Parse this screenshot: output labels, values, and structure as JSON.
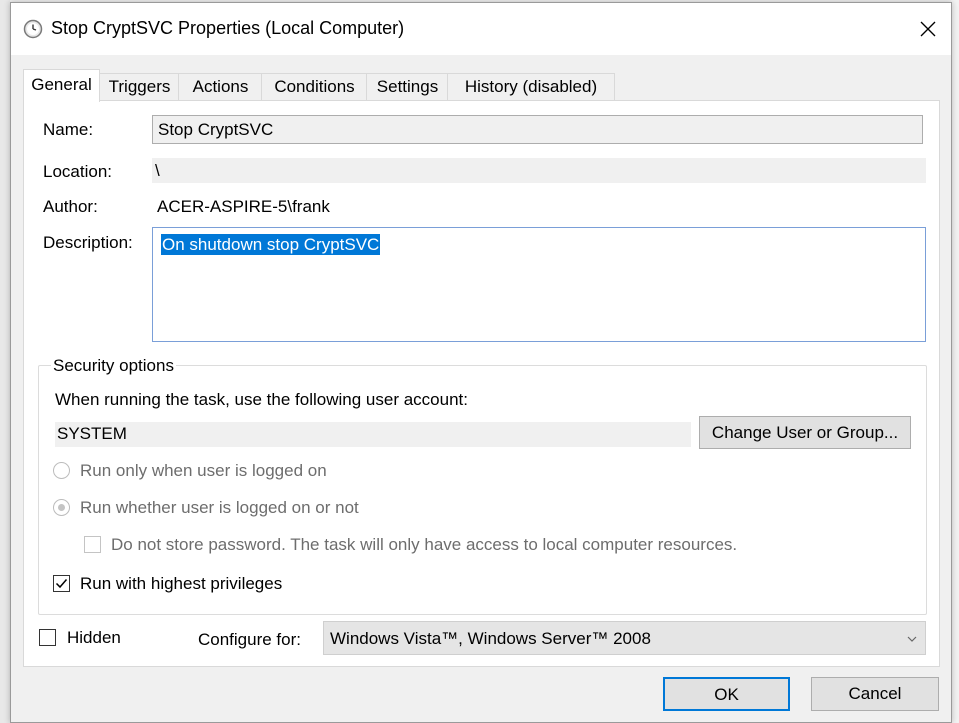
{
  "window": {
    "title": "Stop CryptSVC Properties (Local Computer)",
    "title_icon": "clock-icon",
    "close_icon": "close-icon"
  },
  "tabs": [
    {
      "label": "General",
      "active": true
    },
    {
      "label": "Triggers"
    },
    {
      "label": "Actions"
    },
    {
      "label": "Conditions"
    },
    {
      "label": "Settings"
    },
    {
      "label": "History (disabled)"
    }
  ],
  "general": {
    "name_label": "Name:",
    "name_value": "Stop CryptSVC",
    "location_label": "Location:",
    "location_value": "\\",
    "author_label": "Author:",
    "author_value": "ACER-ASPIRE-5\\frank",
    "description_label": "Description:",
    "description_value": "On shutdown stop CryptSVC"
  },
  "security": {
    "title": "Security options",
    "account_prompt": "When running the task, use the following user account:",
    "account_value": "SYSTEM",
    "change_button": "Change User or Group...",
    "radio_logged_on": "Run only when user is logged on",
    "radio_whether": "Run whether user is logged on or not",
    "radio_selected": "whether",
    "no_store_password": "Do not store password.  The task will only have access to local computer resources.",
    "no_store_password_checked": false,
    "highest_privileges": "Run with highest privileges",
    "highest_privileges_checked": true
  },
  "footer": {
    "hidden_label": "Hidden",
    "hidden_checked": false,
    "configure_label": "Configure for:",
    "configure_value": "Windows Vista™, Windows Server™ 2008",
    "ok": "OK",
    "cancel": "Cancel"
  },
  "colors": {
    "accent": "#0078d7",
    "selection": "#0078d7"
  }
}
